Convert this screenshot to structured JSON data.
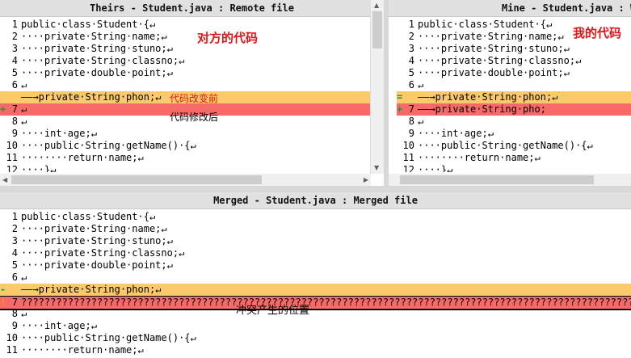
{
  "theirs": {
    "title": "Theirs - Student.java : Remote file",
    "annotation": "对方的代码",
    "change_note": "代码改变前",
    "modified_note": "代码修改后",
    "lines": [
      {
        "n": "1",
        "text": "public·class·Student·{↵"
      },
      {
        "n": "2",
        "text": "····private·String·name;↵"
      },
      {
        "n": "3",
        "text": "····private·String·stuno;↵"
      },
      {
        "n": "4",
        "text": "····private·String·classno;↵"
      },
      {
        "n": "5",
        "text": "····private·double·point;↵"
      },
      {
        "n": "6",
        "text": "↵"
      },
      {
        "n": "",
        "text": "——→private·String·phon;↵",
        "mark": "",
        "hl": "orange"
      },
      {
        "n": "7",
        "text": "↵",
        "mark": "+",
        "hl": "red"
      },
      {
        "n": "8",
        "text": "↵"
      },
      {
        "n": "9",
        "text": "····int·age;↵"
      },
      {
        "n": "10",
        "text": "····public·String·getName()·{↵"
      },
      {
        "n": "11",
        "text": "········return·name;↵"
      },
      {
        "n": "12",
        "text": "····}↵"
      }
    ]
  },
  "mine": {
    "title": "Mine - Student.java : Working",
    "annotation": "我的代码",
    "lines": [
      {
        "n": "1",
        "text": "public·class·Student·{↵"
      },
      {
        "n": "2",
        "text": "····private·String·name;↵"
      },
      {
        "n": "3",
        "text": "····private·String·stuno;↵"
      },
      {
        "n": "4",
        "text": "····private·String·classno;↵"
      },
      {
        "n": "5",
        "text": "····private·double·point;↵"
      },
      {
        "n": "6",
        "text": "↵"
      },
      {
        "n": "",
        "text": "——→private·String·phon;↵",
        "mark": "=",
        "hl": "orange"
      },
      {
        "n": "7",
        "text": "——→private·String·pho;",
        "mark": "+",
        "hl": "red"
      },
      {
        "n": "8",
        "text": "↵"
      },
      {
        "n": "9",
        "text": "····int·age;↵"
      },
      {
        "n": "10",
        "text": "····public·String·getName()·{↵"
      },
      {
        "n": "11",
        "text": "········return·name;↵"
      },
      {
        "n": "12",
        "text": "····}↵"
      }
    ]
  },
  "merged": {
    "title": "Merged - Student.java : Merged file",
    "conflict_note": "冲突产生的位置",
    "lines": [
      {
        "n": "1",
        "text": "public·class·Student·{↵"
      },
      {
        "n": "2",
        "text": "····private·String·name;↵"
      },
      {
        "n": "3",
        "text": "····private·String·stuno;↵"
      },
      {
        "n": "4",
        "text": "····private·String·classno;↵"
      },
      {
        "n": "5",
        "text": "····private·double·point;↵"
      },
      {
        "n": "6",
        "text": "↵"
      },
      {
        "n": "",
        "text": "——→private·String·phon;↵",
        "mark": "-",
        "hl": "orange"
      },
      {
        "n": "7",
        "text": "??????????????????????????????????????????????????????????????????????????????????????????????????????????????????????",
        "mark": "!",
        "hl": "conflict"
      },
      {
        "n": "8",
        "text": "↵"
      },
      {
        "n": "9",
        "text": "····int·age;↵"
      },
      {
        "n": "10",
        "text": "····public·String·getName()·{↵"
      },
      {
        "n": "11",
        "text": "········return·name;↵"
      }
    ]
  }
}
